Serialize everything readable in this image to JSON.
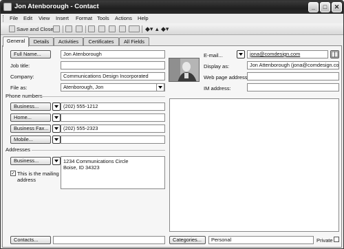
{
  "window": {
    "title": "Jon Atenborough - Contact"
  },
  "menu": [
    "File",
    "Edit",
    "View",
    "Insert",
    "Format",
    "Tools",
    "Actions",
    "Help"
  ],
  "toolbar": {
    "save_close_label": "Save and Close"
  },
  "tabs": [
    "General",
    "Details",
    "Activities",
    "Certificates",
    "All Fields"
  ],
  "left": {
    "full_name_button": "Full Name...",
    "full_name_value": "Jon Atenborough",
    "job_title_label": "Job title:",
    "job_title_value": "",
    "company_label": "Company:",
    "company_value": "Communications Design Incorporated",
    "file_as_label": "File as:",
    "file_as_value": "Atenborough, Jon"
  },
  "phones": {
    "section_label": "Phone numbers",
    "items": [
      {
        "type": "Business...",
        "value": "(202) 555-1212"
      },
      {
        "type": "Home...",
        "value": ""
      },
      {
        "type": "Business Fax...",
        "value": "(202) 555-2323"
      },
      {
        "type": "Mobile...",
        "value": ""
      }
    ]
  },
  "addresses": {
    "section_label": "Addresses",
    "type_button": "Business...",
    "line1": "1234 Communications Circle",
    "line2": "Boise, ID 34323",
    "mailing_checkbox_text_1": "This is the mailing",
    "mailing_checkbox_text_2": "address",
    "mailing_checked": true
  },
  "right": {
    "email_button": "E-mail...",
    "email_value": "jona@comdesign.com",
    "display_as_label": "Display as:",
    "display_as_value": "Jon Attenborough (jona@comdesign.com)",
    "web_label": "Web page address:",
    "web_value": "",
    "im_label": "IM address:",
    "im_value": ""
  },
  "bottom": {
    "contacts_button": "Contacts...",
    "contacts_value": "",
    "categories_button": "Categories...",
    "categories_value": "Personal",
    "private_label": "Private"
  }
}
